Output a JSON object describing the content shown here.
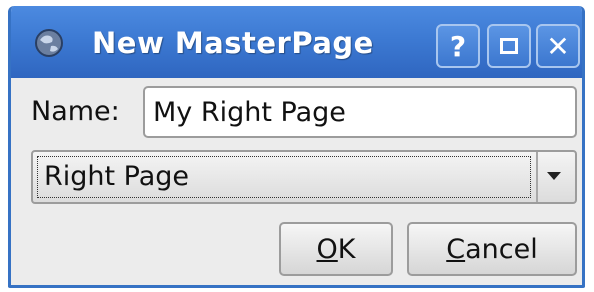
{
  "window": {
    "title": "New MasterPage",
    "help_glyph": "?",
    "close_glyph": "✕",
    "icon": "globe-icon"
  },
  "form": {
    "name_label": "Name:",
    "name_value": "My Right Page",
    "page_type_selected": "Right Page"
  },
  "buttons": {
    "ok_mnemonic": "O",
    "ok_rest": "K",
    "cancel_mnemonic": "C",
    "cancel_rest": "ancel"
  },
  "colors": {
    "titlebar": "#3d7ad3",
    "window_bg": "#ececec"
  }
}
